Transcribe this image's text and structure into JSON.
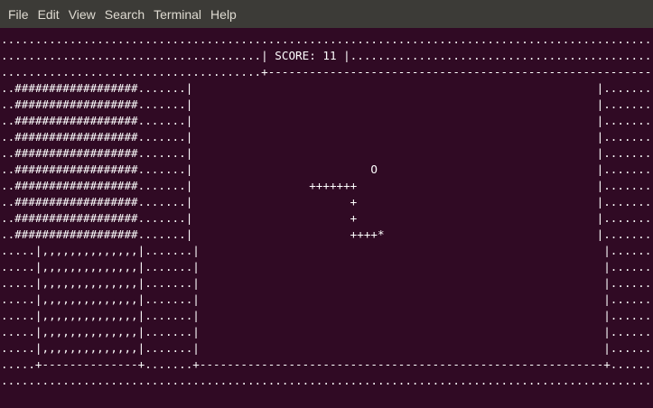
{
  "menu": {
    "items": [
      "File",
      "Edit",
      "View",
      "Search",
      "Terminal",
      "Help"
    ]
  },
  "terminal": {
    "score_label": "SCORE:",
    "score_value": "11",
    "lines": [
      "............................................................................................................",
      "......................................| SCORE: 11 |.........................................................",
      "......................................+-----------------------------------------------------------+.........",
      "..##################.......|                                                           |.........",
      "..##################.......|                                                           |.........",
      "..##################.......|                                                           |.........",
      "..##################.......|                                                           |.........",
      "..##################.......|                                                           |.........",
      "..##################.......|                          O                                |.........",
      "..##################.......|                 +++++++                                   |.........",
      "..##################.......|                       +                                   |.........",
      "..##################.......|                       +                                   |.........",
      "..##################.......|                       ++++*                               |.........",
      ".....|,,,,,,,,,,,,,,|.......|                                                           |.........",
      ".....|,,,,,,,,,,,,,,|.......|                                                           |.........",
      ".....|,,,,,,,,,,,,,,|.......|                                                           |.........",
      ".....|,,,,,,,,,,,,,,|.......|                                                           |.........",
      ".....|,,,,,,,,,,,,,,|.......|                                                           |.........",
      ".....|,,,,,,,,,,,,,,|.......|                                                           |.........",
      ".....|,,,,,,,,,,,,,,|.......|                                                           |.........",
      ".....+--------------+.......+-----------------------------------------------------------+.........",
      "............................................................................................................"
    ]
  }
}
